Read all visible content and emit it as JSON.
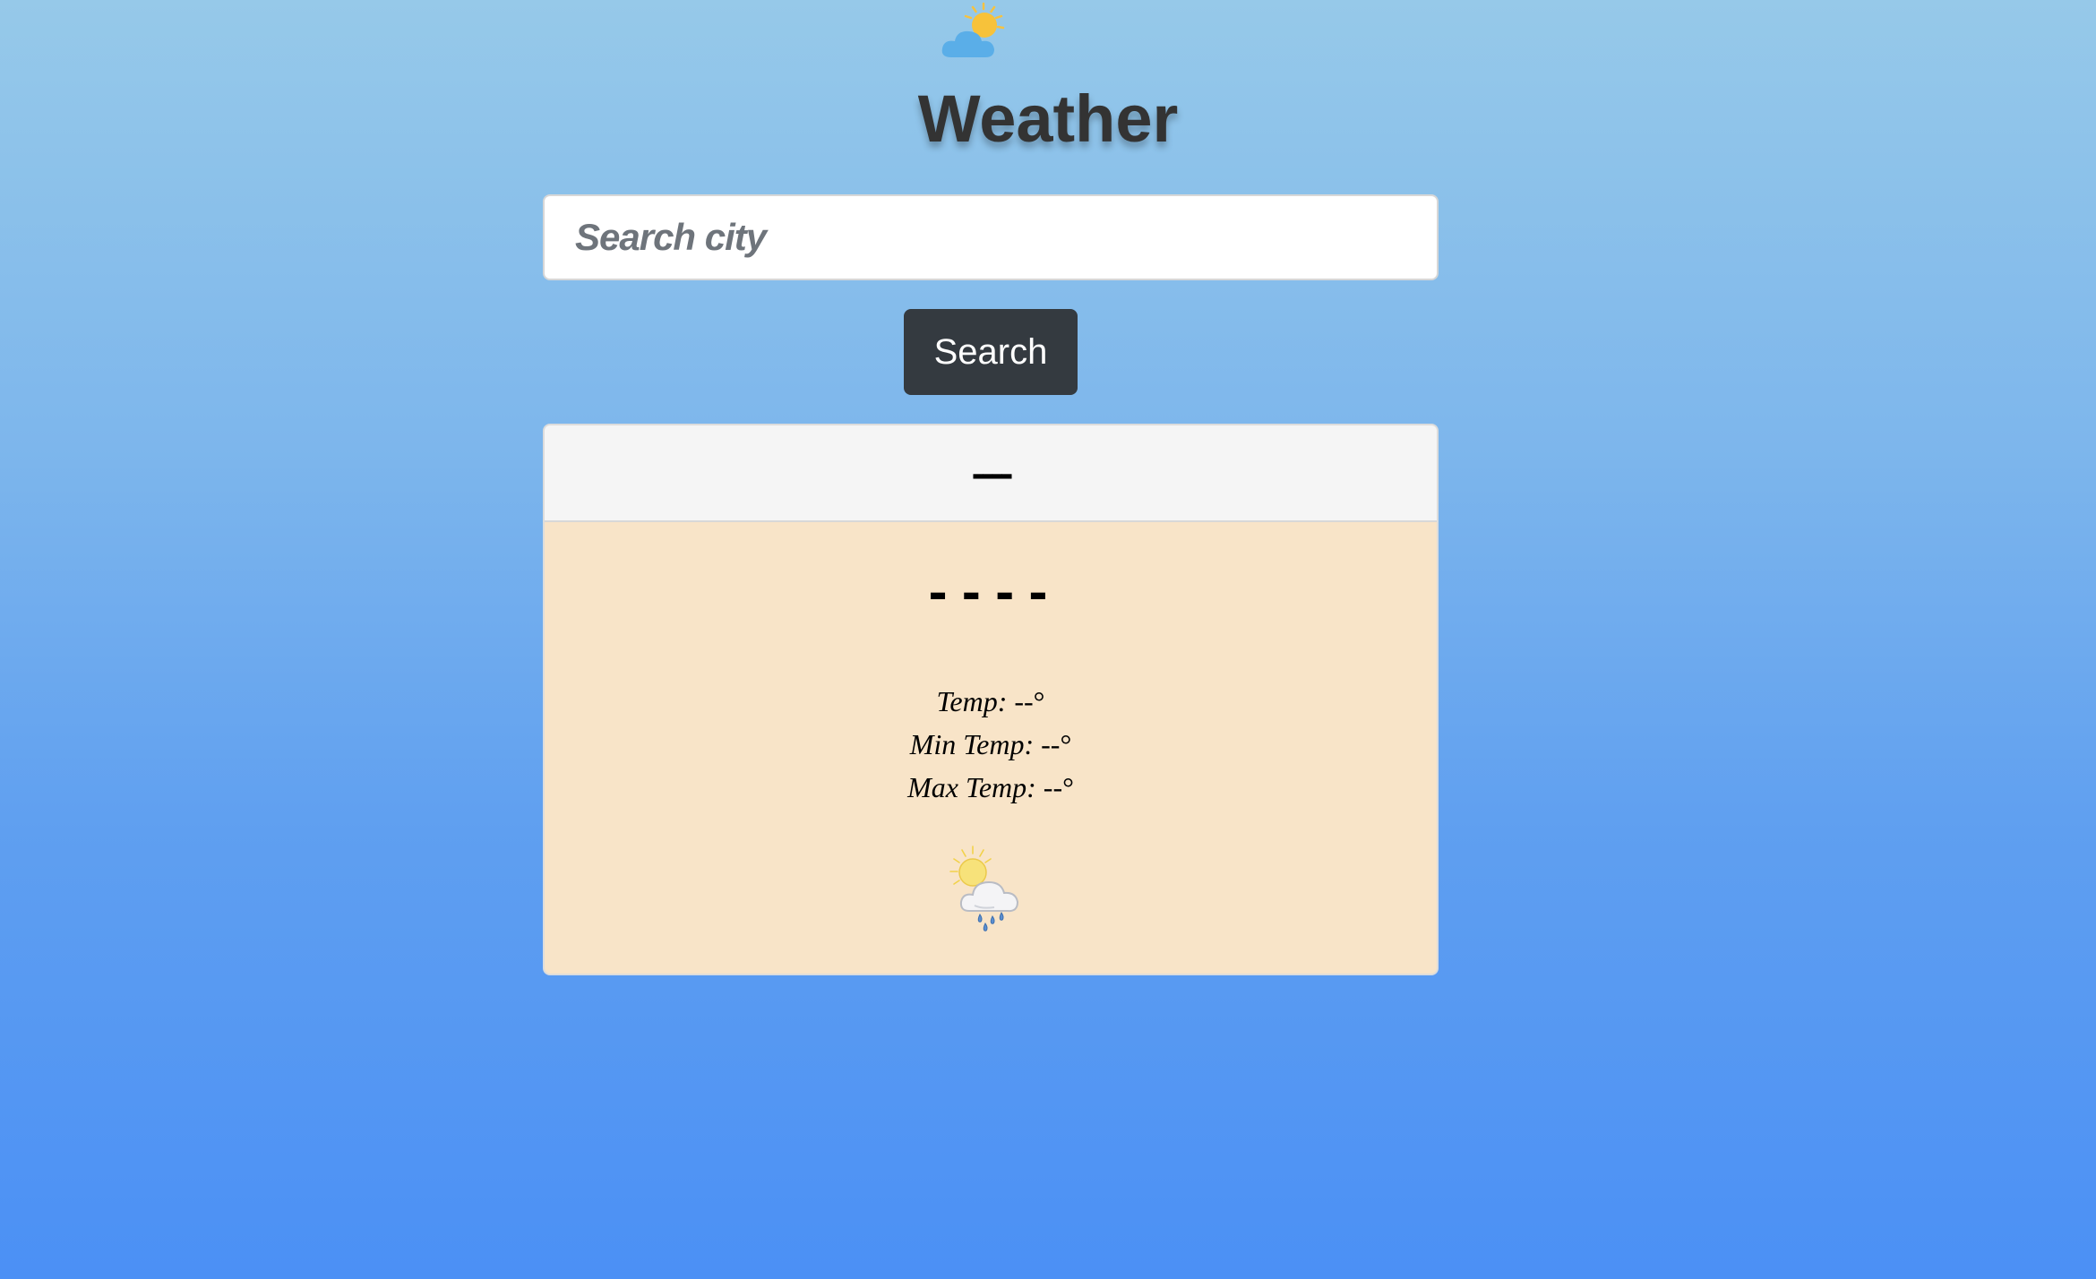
{
  "header": {
    "title": "Weather",
    "logo_icon": "sun-behind-cloud-icon"
  },
  "search": {
    "placeholder": "Search city",
    "value": "",
    "button_label": "Search"
  },
  "card": {
    "city": "----",
    "condition": "----",
    "temperature": {
      "temp_label": "Temp:",
      "temp_value": " --°",
      "min_label": "Min Temp:",
      "min_value": " --°",
      "max_label": "Max Temp:",
      "max_value": " --°"
    },
    "weather_icon": "sun-behind-rain-cloud-icon"
  },
  "colors": {
    "background_top": "#96c9e9",
    "background_bottom": "#4b90f5",
    "title": "#333333",
    "button_bg": "#343a40",
    "card_header_bg": "#f5f5f5",
    "card_body_bg": "#f8e4c8"
  }
}
